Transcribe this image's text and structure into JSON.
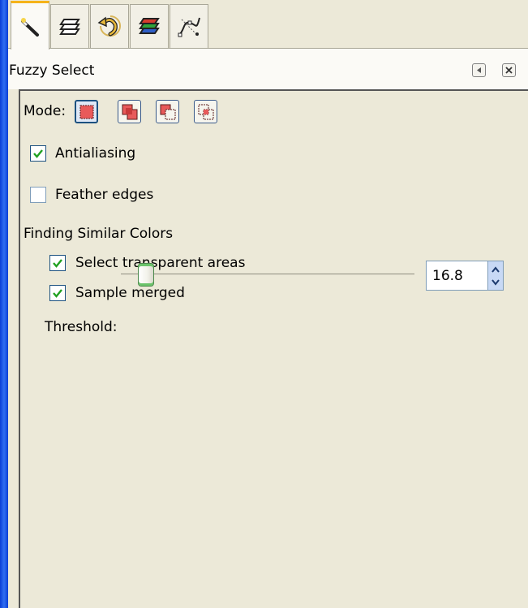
{
  "tabs": [
    {
      "icon": "magic-wand-icon",
      "active": true
    },
    {
      "icon": "layers-icon",
      "active": false
    },
    {
      "icon": "undo-history-icon",
      "active": false
    },
    {
      "icon": "channels-icon",
      "active": false
    },
    {
      "icon": "paths-icon",
      "active": false
    }
  ],
  "panel": {
    "title": "Fuzzy Select",
    "menu_icon": "tab-menu-icon",
    "close_icon": "close-icon"
  },
  "tool_options": {
    "mode_label": "Mode:",
    "modes": [
      {
        "icon": "mode-replace-icon",
        "active": true
      },
      {
        "icon": "mode-add-icon",
        "active": false
      },
      {
        "icon": "mode-subtract-icon",
        "active": false
      },
      {
        "icon": "mode-intersect-icon",
        "active": false
      }
    ],
    "antialiasing": {
      "label": "Antialiasing",
      "checked": true
    },
    "feather_edges": {
      "label": "Feather edges",
      "checked": false
    },
    "similar_colors": {
      "section_label": "Finding Similar Colors",
      "select_transparent": {
        "label": "Select transparent areas",
        "checked": true
      },
      "sample_merged": {
        "label": "Sample merged",
        "checked": true
      },
      "threshold": {
        "label": "Threshold:",
        "value": "16.8",
        "fraction": 0.066
      }
    }
  },
  "colors": {
    "window_border": "#2456dc",
    "active_tab_accent": "#f5b31a",
    "checkmark": "#21a121",
    "panel_bg": "#ece9d8"
  }
}
